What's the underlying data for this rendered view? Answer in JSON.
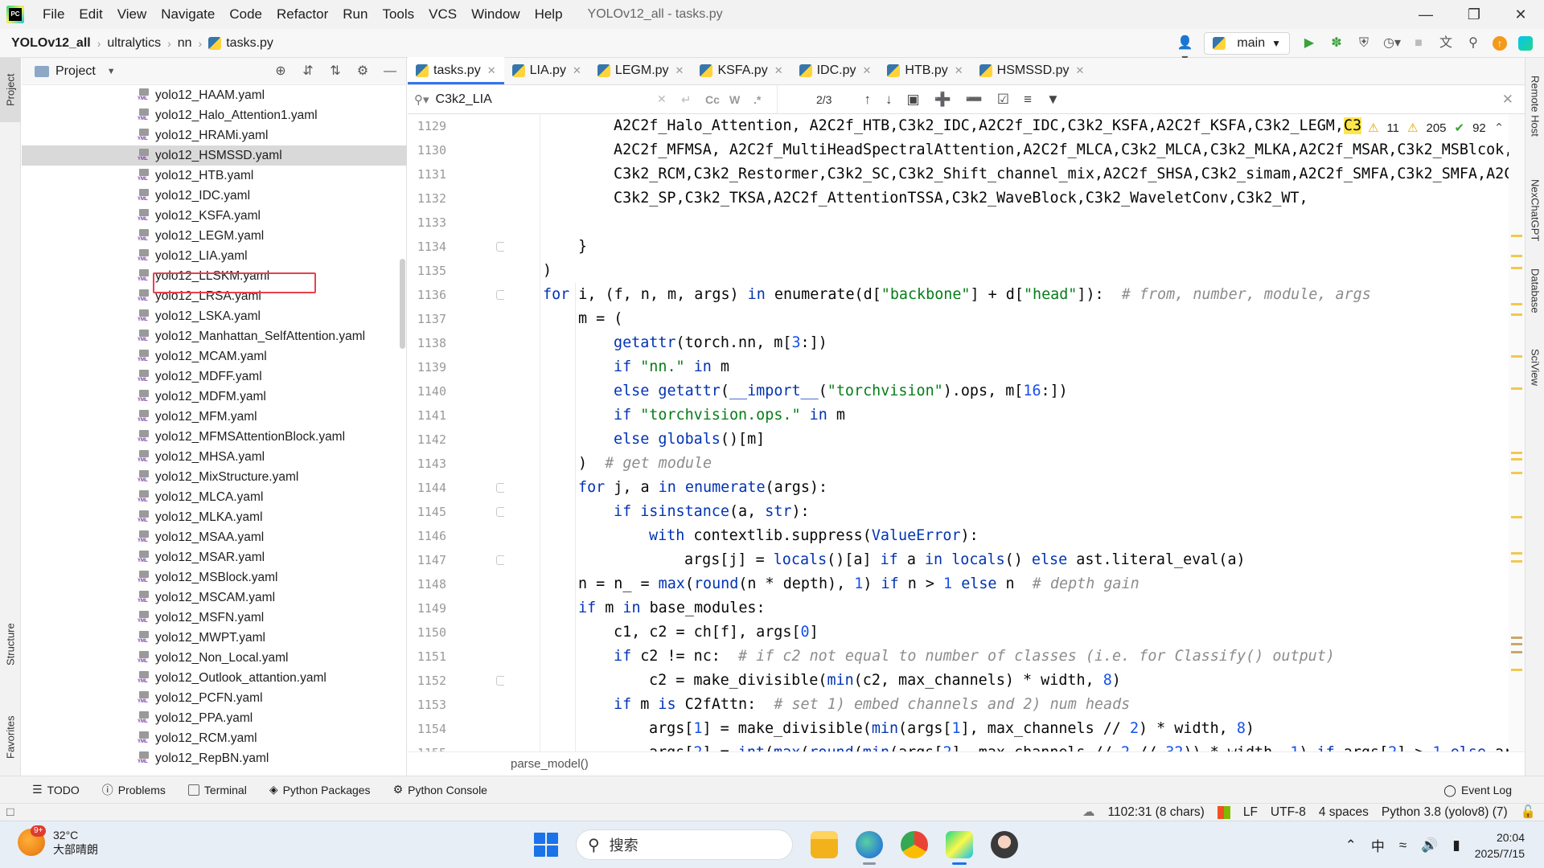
{
  "menubar": {
    "items": [
      {
        "label": "File"
      },
      {
        "label": "Edit"
      },
      {
        "label": "View"
      },
      {
        "label": "Navigate"
      },
      {
        "label": "Code"
      },
      {
        "label": "Refactor"
      },
      {
        "label": "Run"
      },
      {
        "label": "Tools"
      },
      {
        "label": "VCS"
      },
      {
        "label": "Window"
      },
      {
        "label": "Help"
      }
    ],
    "window_title": "YOLOv12_all - tasks.py"
  },
  "navbar": {
    "breadcrumbs": [
      "YOLOv12_all",
      "ultralytics",
      "nn",
      "tasks.py"
    ],
    "branch": "main"
  },
  "left_stripe": {
    "project_tab": "Project",
    "structure_tab": "Structure",
    "favorites_tab": "Favorites"
  },
  "project_panel": {
    "title": "Project",
    "items": [
      "yolo12_HAAM.yaml",
      "yolo12_Halo_Attention1.yaml",
      "yolo12_HRAMi.yaml",
      "yolo12_HSMSSD.yaml",
      "yolo12_HTB.yaml",
      "yolo12_IDC.yaml",
      "yolo12_KSFA.yaml",
      "yolo12_LEGM.yaml",
      "yolo12_LIA.yaml",
      "yolo12_LLSKM.yaml",
      "yolo12_LRSA.yaml",
      "yolo12_LSKA.yaml",
      "yolo12_Manhattan_SelfAttention.yaml",
      "yolo12_MCAM.yaml",
      "yolo12_MDFF.yaml",
      "yolo12_MDFM.yaml",
      "yolo12_MFM.yaml",
      "yolo12_MFMSAttentionBlock.yaml",
      "yolo12_MHSA.yaml",
      "yolo12_MixStructure.yaml",
      "yolo12_MLCA.yaml",
      "yolo12_MLKA.yaml",
      "yolo12_MSAA.yaml",
      "yolo12_MSAR.yaml",
      "yolo12_MSBlock.yaml",
      "yolo12_MSCAM.yaml",
      "yolo12_MSFN.yaml",
      "yolo12_MWPT.yaml",
      "yolo12_Non_Local.yaml",
      "yolo12_Outlook_attantion.yaml",
      "yolo12_PCFN.yaml",
      "yolo12_PPA.yaml",
      "yolo12_RCM.yaml",
      "yolo12_RepBN.yaml"
    ],
    "selected": "yolo12_HSMSSD.yaml",
    "highlighted": "yolo12_LIA.yaml"
  },
  "editor": {
    "tabs": [
      "tasks.py",
      "LIA.py",
      "LEGM.py",
      "KSFA.py",
      "IDC.py",
      "HTB.py",
      "HSMSSD.py"
    ],
    "active_tab": "tasks.py",
    "find": {
      "query": "C3k2_LIA",
      "count": "2/3",
      "tool_cc": "Cc",
      "tool_w": "W",
      "tool_regex": ".*"
    },
    "inspections": {
      "warnings": "11",
      "weak_warnings": "205",
      "ok": "92"
    },
    "breadcrumb": "parse_model()",
    "line_numbers": [
      "1129",
      "1130",
      "1131",
      "1132",
      "1133",
      "1134",
      "1135",
      "1136",
      "1137",
      "1138",
      "1139",
      "1140",
      "1141",
      "1142",
      "1143",
      "1144",
      "1145",
      "1146",
      "1147",
      "1148",
      "1149",
      "1150",
      "1151",
      "1152",
      "1153",
      "1154",
      "1155"
    ]
  },
  "right_stripe": {
    "tabs": [
      "Remote Host",
      "NexChatGPT",
      "Database",
      "SciView"
    ]
  },
  "toolwindows": {
    "items": [
      "TODO",
      "Problems",
      "Terminal",
      "Python Packages",
      "Python Console"
    ],
    "event_log": "Event Log"
  },
  "statusbar": {
    "position": "1102:31 (8 chars)",
    "line_sep": "LF",
    "encoding": "UTF-8",
    "indent": "4 spaces",
    "interpreter": "Python 3.8 (yolov8) (7)"
  },
  "taskbar": {
    "weather_temp": "32°C",
    "weather_desc": "大部晴朗",
    "weather_badge": "9+",
    "search_placeholder": "搜索",
    "ime": "中",
    "time": "20:04",
    "date": "2025/7/15"
  },
  "colors": {
    "accent": "#3574f0",
    "highlight_border": "#e8414d",
    "keyword": "#0033b3",
    "string": "#067d17",
    "number": "#1750eb",
    "comment": "#8c8c8c",
    "search_match": "#fde64b"
  }
}
